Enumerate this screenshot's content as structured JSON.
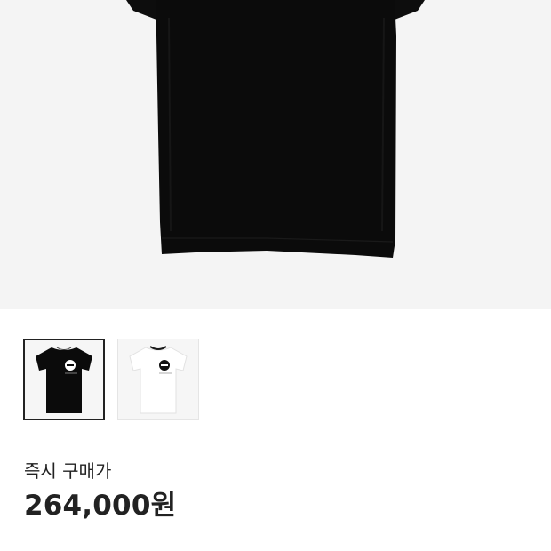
{
  "product": {
    "thumbnails": [
      {
        "variant": "black",
        "selected": true
      },
      {
        "variant": "white",
        "selected": false
      }
    ],
    "price_label": "즉시 구매가",
    "price": "264,000원"
  },
  "colors": {
    "hero_bg": "#f4f4f4",
    "shirt_black": "#0b0b0b",
    "shirt_white": "#ffffff",
    "text": "#222222",
    "selected_border": "#222222"
  }
}
